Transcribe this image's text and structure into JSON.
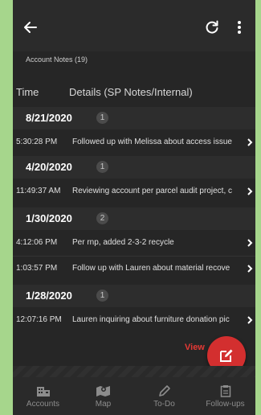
{
  "header": {
    "back_icon": "arrow-left-icon",
    "refresh_icon": "refresh-icon",
    "more_icon": "more-vertical-icon"
  },
  "subtitle": "Account Notes (19)",
  "columns": {
    "time": "Time",
    "details": "Details (SP Notes/Internal)"
  },
  "groups": [
    {
      "date": "8/21/2020",
      "count": "1",
      "notes": [
        {
          "time": "5:30:28 PM",
          "text": "Followed up with Melissa about access issue"
        }
      ]
    },
    {
      "date": "4/20/2020",
      "count": "1",
      "notes": [
        {
          "time": "11:49:37 AM",
          "text": "Reviewing account per parcel audit project, c"
        }
      ]
    },
    {
      "date": "1/30/2020",
      "count": "2",
      "notes": [
        {
          "time": "4:12:06 PM",
          "text": "Per rnp, added 2-3-2 recycle"
        },
        {
          "time": "1:03:57 PM",
          "text": "Follow up with Lauren about material recove"
        }
      ]
    },
    {
      "date": "1/28/2020",
      "count": "1",
      "notes": [
        {
          "time": "12:07:16 PM",
          "text": "Lauren inquiring about furniture donation pic"
        }
      ]
    }
  ],
  "fab": {
    "label": "View",
    "icon": "edit-icon"
  },
  "bottom_nav": [
    {
      "label": "Accounts",
      "icon": "building-icon"
    },
    {
      "label": "Map",
      "icon": "map-icon"
    },
    {
      "label": "To-Do",
      "icon": "pencil-icon"
    },
    {
      "label": "Follow-ups",
      "icon": "clipboard-icon"
    }
  ],
  "colors": {
    "accent": "#d32f2f",
    "background": "#262626",
    "page": "#a6d68c"
  }
}
